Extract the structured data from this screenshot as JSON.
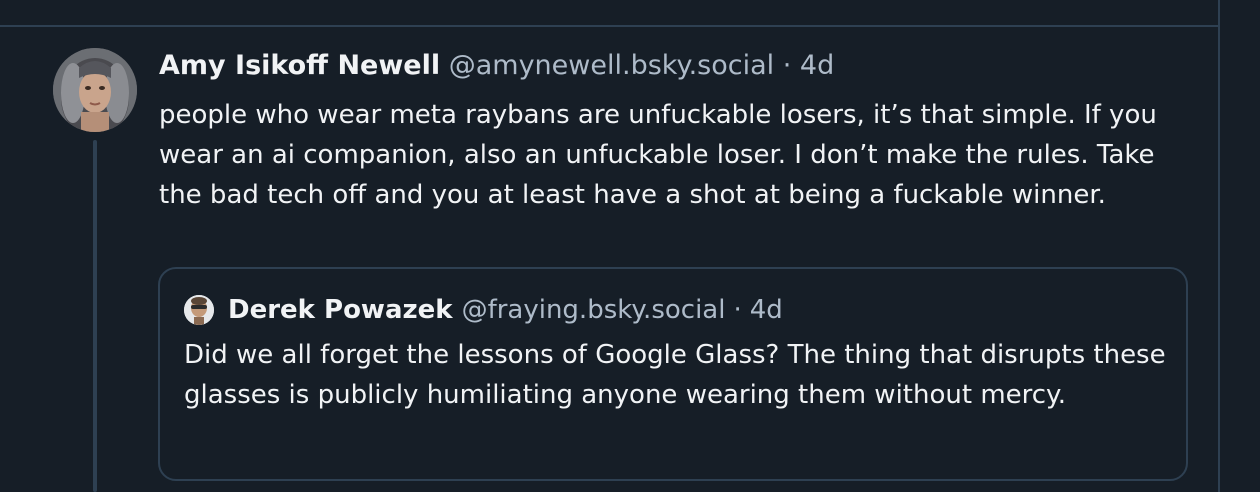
{
  "post": {
    "author_name": "Amy Isikoff Newell",
    "author_handle": "@amynewell.bsky.social",
    "separator": "·",
    "time": "4d",
    "text": "people who wear meta raybans are unfuckable losers, it’s that simple. If you wear an ai companion, also an unfuckable loser. I don’t make the rules. Take the bad tech off and you at least have a shot at being a fuckable winner."
  },
  "quote": {
    "author_name": "Derek Powazek",
    "author_handle": "@fraying.bsky.social",
    "separator": "·",
    "time": "4d",
    "text": "Did we all forget the lessons of Google Glass? The thing that disrupts these glasses is publicly humiliating anyone wearing them without mercy."
  },
  "colors": {
    "background": "#161e27",
    "border": "#2e4052",
    "text_primary": "#f1f3f5",
    "text_secondary": "#aebbc9"
  }
}
